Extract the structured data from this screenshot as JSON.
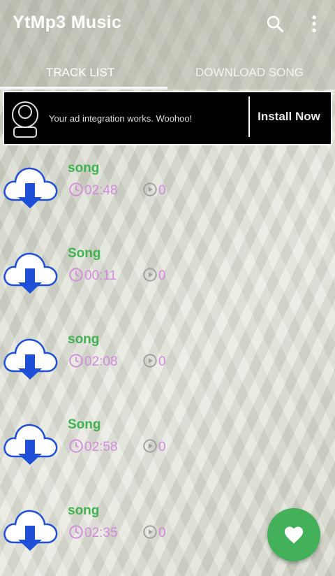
{
  "app": {
    "title": "YtMp3 Music"
  },
  "tabs": [
    {
      "label": "TRACK LIST"
    },
    {
      "label": "DOWNLOAD SONG"
    }
  ],
  "ad": {
    "text": "Your ad integration works. Woohoo!",
    "button": "Install Now"
  },
  "tracks": [
    {
      "title": "song",
      "duration": "02:48",
      "plays": "0"
    },
    {
      "title": "Song",
      "duration": "00:11",
      "plays": "0"
    },
    {
      "title": "song",
      "duration": "02:08",
      "plays": "0"
    },
    {
      "title": "Song",
      "duration": "02:58",
      "plays": "0"
    },
    {
      "title": "song",
      "duration": "02:35",
      "plays": "0"
    }
  ],
  "icons": {
    "search": "search-icon",
    "menu": "more-vert-icon",
    "download": "cloud-download-icon",
    "duration": "clock-icon",
    "plays": "play-circle-icon",
    "favorite": "heart-icon"
  },
  "colors": {
    "accent": "#43b05a",
    "title_green": "#3fb34f",
    "meta_pink": "#d48ae0",
    "cloud_blue": "#1f4fd8"
  }
}
